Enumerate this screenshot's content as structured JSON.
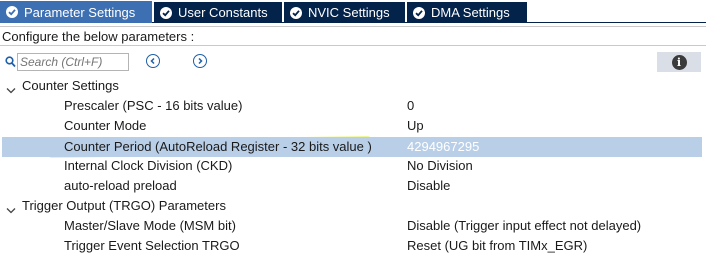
{
  "tabs": [
    {
      "label": "Parameter Settings",
      "active": true
    },
    {
      "label": "User Constants",
      "active": false
    },
    {
      "label": "NVIC Settings",
      "active": false
    },
    {
      "label": "DMA Settings",
      "active": false
    }
  ],
  "configure_text": "Configure the below parameters :",
  "search": {
    "placeholder": "Search (Ctrl+F)"
  },
  "icons": {
    "search": "search-icon",
    "prev": "arrow-left-circle-icon",
    "next": "arrow-right-circle-icon",
    "info": "info-icon",
    "expand": "chevron-down-icon"
  },
  "info_glyph": "i",
  "groups": [
    {
      "label": "Counter Settings",
      "params": [
        {
          "name": "Prescaler (PSC - 16 bits value)",
          "value": "0"
        },
        {
          "name": "Counter Mode",
          "value": "Up"
        },
        {
          "name": "Counter Period (AutoReload Register - 32 bits value )",
          "value": "4294967295",
          "selected": true,
          "highlighted": true
        },
        {
          "name": "Internal Clock Division (CKD)",
          "value": "No Division"
        },
        {
          "name": "auto-reload preload",
          "value": "Disable"
        }
      ]
    },
    {
      "label": "Trigger Output (TRGO) Parameters",
      "params": [
        {
          "name": "Master/Slave Mode (MSM bit)",
          "value": "Disable (Trigger input effect not delayed)"
        },
        {
          "name": "Trigger Event Selection TRGO",
          "value": "Reset (UG bit from TIMx_EGR)"
        }
      ]
    }
  ],
  "colors": {
    "tab_inactive": "#03234b",
    "tab_active": "#3d6fb3",
    "selected_row": "#b9cfe8",
    "marker_highlight": "#dcec1e",
    "nav_icon": "#1f5fa8"
  }
}
